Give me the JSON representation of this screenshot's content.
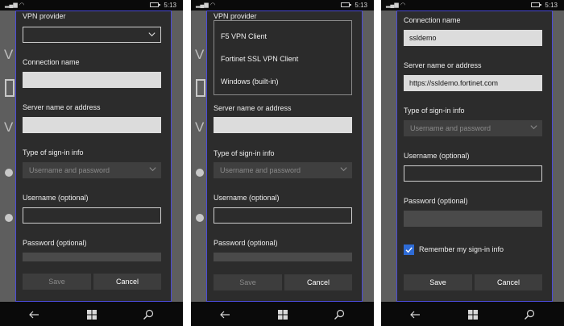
{
  "status": {
    "time": "5:13"
  },
  "background": {
    "char": "V"
  },
  "labels": {
    "vpn_provider": "VPN provider",
    "connection_name": "Connection name",
    "server": "Server name or address",
    "signin_type": "Type of sign-in info",
    "username": "Username (optional)",
    "password": "Password (optional)",
    "remember": "Remember my sign-in info"
  },
  "signin_value": "Username and password",
  "buttons": {
    "save": "Save",
    "cancel": "Cancel"
  },
  "provider_options": [
    "F5 VPN Client",
    "Fortinet SSL VPN Client",
    "Windows (built-in)"
  ],
  "screen3": {
    "connection_name_value": "ssldemo",
    "server_value": "https://ssldemo.fortinet.com",
    "remember_checked": true
  },
  "icons": {
    "back": "back-arrow-icon",
    "start": "windows-logo-icon",
    "search": "search-icon"
  }
}
